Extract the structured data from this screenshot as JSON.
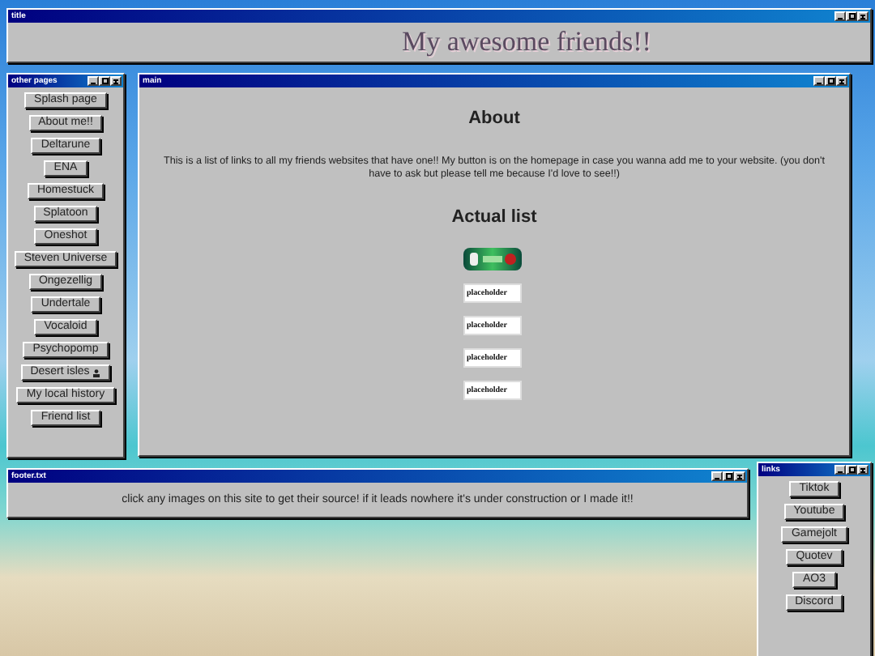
{
  "windows": [
    {
      "kind": "banner",
      "title": "title",
      "heading": "My awesome friends!!"
    },
    {
      "kind": "buttons",
      "title": "other pages",
      "buttons": [
        {
          "label": "Splash page"
        },
        {
          "label": "About me!!"
        },
        {
          "label": "Deltarune"
        },
        {
          "label": "ENA"
        },
        {
          "label": "Homestuck"
        },
        {
          "label": "Splatoon"
        },
        {
          "label": "Oneshot"
        },
        {
          "label": "Steven Universe"
        },
        {
          "label": "Ongezellig"
        },
        {
          "label": "Undertale"
        },
        {
          "label": "Vocaloid"
        },
        {
          "label": "Psychopomp"
        },
        {
          "label": "Desert isles",
          "icon": true
        },
        {
          "label": "My local history"
        },
        {
          "label": "Friend list"
        }
      ]
    },
    {
      "kind": "content",
      "title": "main",
      "about_heading": "About",
      "about_text": "This is a list of links to all my friends websites that have one!! My button is on the homepage in case you wanna add me to your website. (you don't have to ask but please tell me because I'd love to see!!)",
      "list_heading": "Actual list",
      "friends": [
        {
          "kind": "badge"
        },
        {
          "kind": "text",
          "label": "placeholder"
        },
        {
          "kind": "text",
          "label": "placeholder"
        },
        {
          "kind": "text",
          "label": "placeholder"
        },
        {
          "kind": "text",
          "label": "placeholder"
        }
      ]
    },
    {
      "kind": "note",
      "title": "footer.txt",
      "text": "click any images on this site to get their source! if it leads nowhere it's under construction or I made it!!"
    },
    {
      "kind": "buttons",
      "title": "links",
      "buttons": [
        {
          "label": "Tiktok"
        },
        {
          "label": "Youtube"
        },
        {
          "label": "Gamejolt"
        },
        {
          "label": "Quotev"
        },
        {
          "label": "AO3"
        },
        {
          "label": "Discord"
        }
      ]
    }
  ]
}
